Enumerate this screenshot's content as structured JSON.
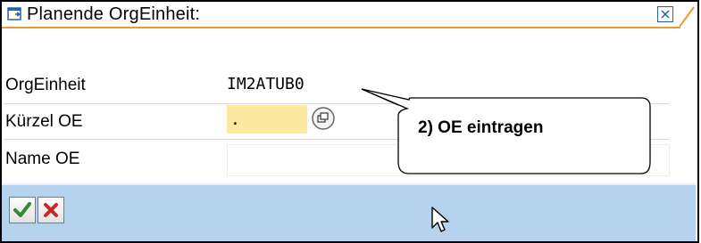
{
  "dialog": {
    "title": "Planende OrgEinheit:",
    "title_icon": "window-icon",
    "close_icon": "close-icon"
  },
  "fields": {
    "orgeinheit": {
      "label": "OrgEinheit",
      "value": "IM2ATUB0"
    },
    "kuerzel_oe": {
      "label": "Kürzel OE",
      "value": ".",
      "help_icon": "value-help-icon"
    },
    "name_oe": {
      "label": "Name OE",
      "value": ""
    }
  },
  "callout": {
    "text": "2) OE eintragen"
  },
  "buttons": {
    "confirm_icon": "checkmark-icon",
    "cancel_icon": "cancel-x-icon"
  },
  "colors": {
    "accent": "#ec9b2f",
    "footer": "#b6d3ee",
    "required_field": "#fdeaa0"
  }
}
